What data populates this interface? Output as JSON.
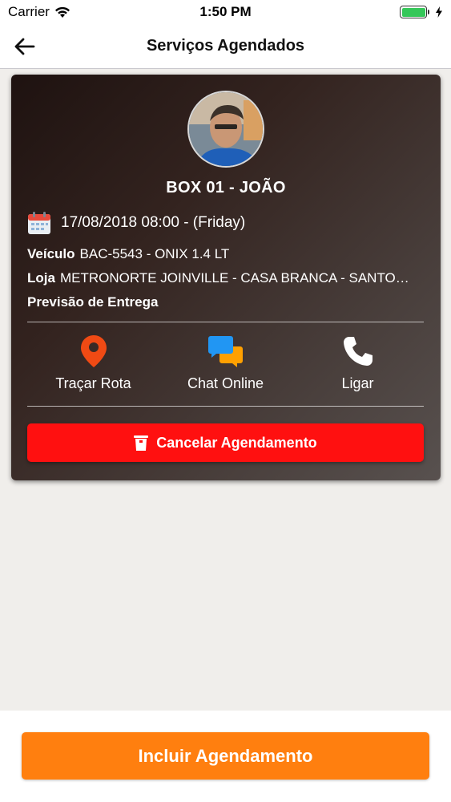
{
  "status_bar": {
    "carrier": "Carrier",
    "time": "1:50 PM"
  },
  "nav": {
    "title": "Serviços Agendados"
  },
  "card": {
    "title": "BOX 01 - JOÃO",
    "datetime": "17/08/2018 08:00 - (Friday)",
    "vehicle_label": "Veículo",
    "vehicle_value": "BAC-5543 - ONIX 1.4 LT",
    "store_label": "Loja",
    "store_value": "METRONORTE JOINVILLE - CASA BRANCA - SANTO…",
    "delivery_label": "Previsão de Entrega",
    "actions": [
      {
        "label": "Traçar Rota",
        "icon": "map-pin-icon",
        "color": "#f04a14"
      },
      {
        "label": "Chat Online",
        "icon": "chat-bubbles-icon",
        "color": "#2196f3"
      },
      {
        "label": "Ligar",
        "icon": "phone-icon",
        "color": "#ffffff"
      }
    ],
    "cancel_label": "Cancelar Agendamento"
  },
  "bottom": {
    "primary_label": "Incluir Agendamento"
  },
  "colors": {
    "accent_orange": "#ff7f0f",
    "cancel_red": "#ff1010",
    "battery_green": "#35c759"
  }
}
